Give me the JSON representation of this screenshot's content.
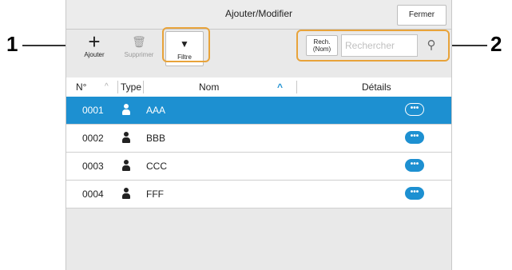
{
  "callouts": [
    {
      "number": "1"
    },
    {
      "number": "2"
    }
  ],
  "dialog": {
    "title": "Ajouter/Modifier",
    "close_label": "Fermer"
  },
  "toolbar": {
    "add": {
      "label": "Ajouter",
      "icon": "plus-icon",
      "glyph": "+"
    },
    "delete": {
      "label": "Supprimer",
      "icon": "trash-icon",
      "glyph": "🗑"
    },
    "filter": {
      "label": "Filtre",
      "icon": "filter-icon",
      "glyph": "▼"
    }
  },
  "search": {
    "scope_line1": "Rech.",
    "scope_line2": "(Nom)",
    "placeholder": "Rechercher",
    "value": "",
    "icon": "search-icon",
    "glyph": "⚲"
  },
  "table": {
    "columns": {
      "number": "N°",
      "type": "Type",
      "name": "Nom",
      "details": "Détails"
    },
    "sort_glyph_number": "^",
    "sort_glyph_name": "^",
    "details_glyph": "•••",
    "rows": [
      {
        "number": "0001",
        "name": "AAA",
        "selected": true
      },
      {
        "number": "0002",
        "name": "BBB",
        "selected": false
      },
      {
        "number": "0003",
        "name": "CCC",
        "selected": false
      },
      {
        "number": "0004",
        "name": "FFF",
        "selected": false
      }
    ]
  },
  "colors": {
    "accent": "#1d90d1",
    "callout_box": "#e8a33a",
    "panel_bg": "#e9e9e9"
  }
}
